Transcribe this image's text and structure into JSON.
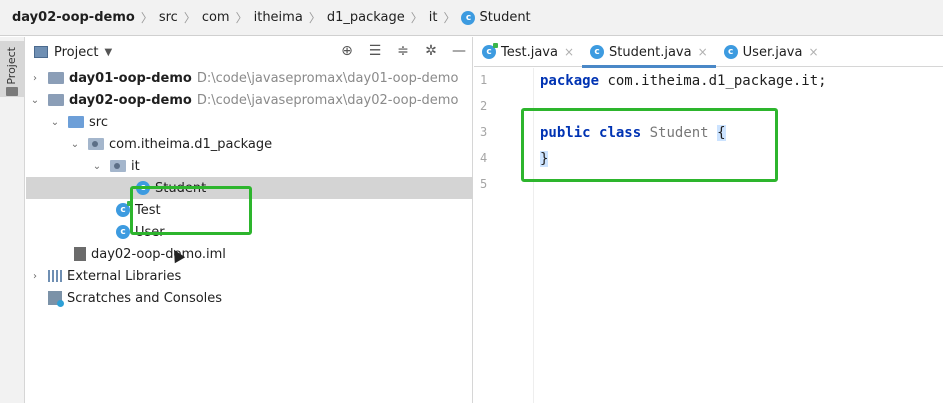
{
  "breadcrumb": {
    "items": [
      "day02-oop-demo",
      "src",
      "com",
      "itheima",
      "d1_package",
      "it",
      "Student"
    ]
  },
  "left_strip": {
    "label": "Project"
  },
  "project_panel": {
    "title": "Project",
    "tree": [
      {
        "label": "day01-oop-demo",
        "path": "D:\\code\\javasepromax\\day01-oop-demo"
      },
      {
        "label": "day02-oop-demo",
        "path": "D:\\code\\javasepromax\\day02-oop-demo"
      },
      {
        "label": "src"
      },
      {
        "label": "com.itheima.d1_package"
      },
      {
        "label": "it"
      },
      {
        "label": "Student"
      },
      {
        "label": "Test"
      },
      {
        "label": "User"
      },
      {
        "label": "day02-oop-demo.iml"
      },
      {
        "label": "External Libraries"
      },
      {
        "label": "Scratches and Consoles"
      }
    ]
  },
  "editor": {
    "tabs": [
      {
        "label": "Test.java"
      },
      {
        "label": "Student.java"
      },
      {
        "label": "User.java"
      }
    ],
    "line_numbers": [
      "1",
      "2",
      "3",
      "4",
      "5"
    ],
    "code": {
      "line1_kw": "package",
      "line1_rest": " com.itheima.d1_package.it;",
      "line3_kw1": "public",
      "line3_kw2": "class",
      "line3_name": "Student",
      "line3_brace": "{",
      "line4_brace": "}"
    }
  },
  "colors": {
    "highlight": "#2db52d",
    "keyword": "#0033b3",
    "class_icon": "#3d9be0"
  }
}
